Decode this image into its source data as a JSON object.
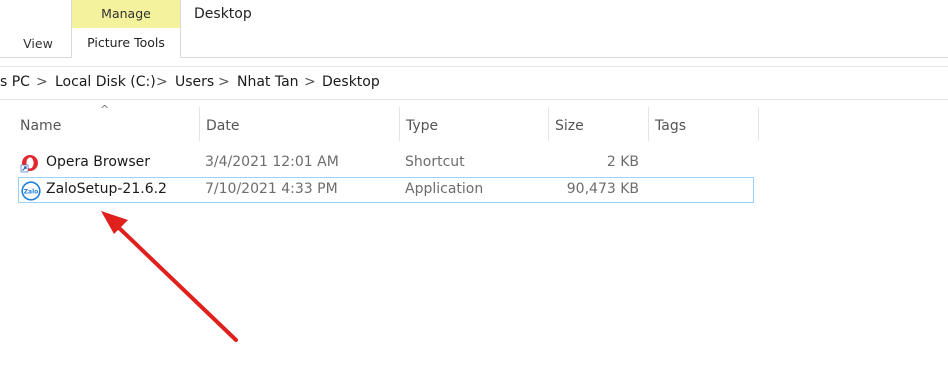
{
  "ribbon": {
    "view_tab": "View",
    "manage_label": "Manage",
    "picture_tools_tab": "Picture Tools",
    "window_title": "Desktop"
  },
  "address": {
    "crumbs": [
      "s PC",
      "Local Disk (C:)",
      "Users",
      "Nhat Tan",
      "Desktop"
    ],
    "separator": ">"
  },
  "columns": {
    "sort_indicator": "^",
    "name": "Name",
    "date": "Date",
    "type": "Type",
    "size": "Size",
    "tags": "Tags"
  },
  "files": [
    {
      "name": "Opera Browser",
      "date": "3/4/2021 12:01 AM",
      "type": "Shortcut",
      "size": "2 KB",
      "icon": "opera-shortcut-icon",
      "selected": false
    },
    {
      "name": "ZaloSetup-21.6.2",
      "date": "7/10/2021 4:33 PM",
      "type": "Application",
      "size": "90,473 KB",
      "icon": "zalo-app-icon",
      "icon_text": "Zalo",
      "selected": true
    }
  ],
  "colors": {
    "manage_bg": "#f4f29c",
    "selection_border": "#99d1ff",
    "annotation_arrow": "#e0201c",
    "opera_red": "#e3262d",
    "zalo_blue": "#1f7fdc"
  }
}
